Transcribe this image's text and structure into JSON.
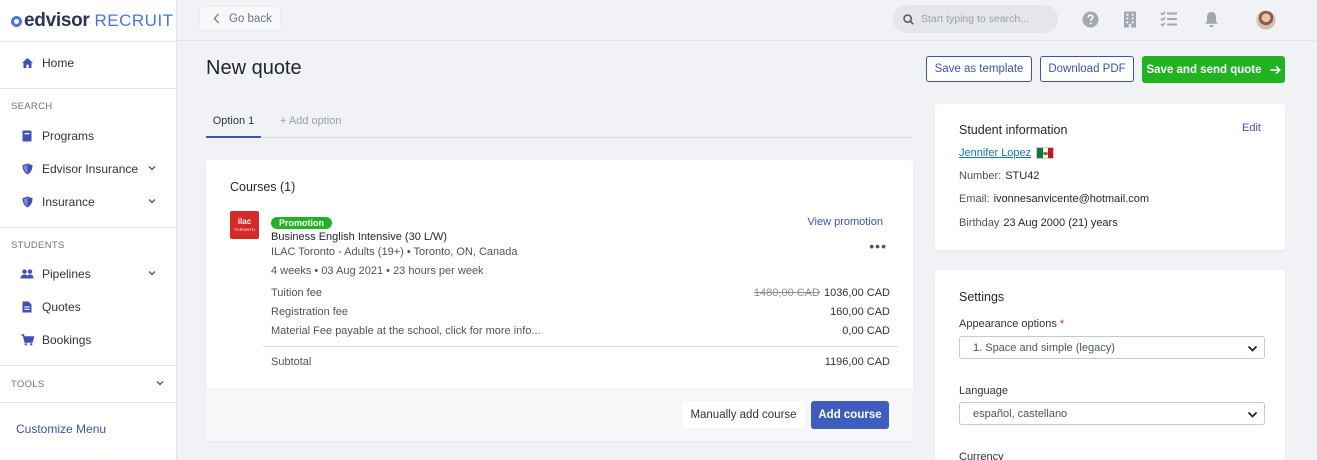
{
  "app": {
    "brand": "edvisor",
    "product": "RECRUIT"
  },
  "sidebar": {
    "home": "Home",
    "search_section": "SEARCH",
    "programs": "Programs",
    "edvisor_insurance": "Edvisor Insurance",
    "insurance": "Insurance",
    "students_section": "STUDENTS",
    "pipelines": "Pipelines",
    "quotes": "Quotes",
    "bookings": "Bookings",
    "tools_section": "TOOLS",
    "customize": "Customize Menu"
  },
  "topbar": {
    "go_back": "Go back",
    "search_placeholder": "Start typing to search..."
  },
  "page": {
    "title": "New quote",
    "save_template": "Save as template",
    "download_pdf": "Download PDF",
    "save_send": "Save and send quote"
  },
  "tabs": {
    "option1": "Option 1",
    "add_option": "+ Add option"
  },
  "courses": {
    "title": "Courses (1)",
    "school_logo_text": "ilac",
    "school_logo_sub": "TORONTO",
    "promo_badge": "Promotion",
    "view_promotion": "View promotion",
    "course_name": "Business English Intensive (30 L/W)",
    "school_line": "ILAC Toronto - Adults (19+) • Toronto, ON, Canada",
    "duration_line": "4 weeks • 03 Aug 2021 • 23 hours per week",
    "fees": [
      {
        "label": "Tuition fee",
        "old": "1480,00 CAD",
        "value": "1036,00 CAD"
      },
      {
        "label": "Registration fee",
        "old": "",
        "value": "160,00 CAD"
      },
      {
        "label": "Material Fee payable at the school, click for more info...",
        "old": "",
        "value": "0,00 CAD"
      }
    ],
    "subtotal_label": "Subtotal",
    "subtotal_value": "1196,00 CAD",
    "manual_add": "Manually add course",
    "add_course": "Add course"
  },
  "student": {
    "title": "Student information",
    "edit": "Edit",
    "name": "Jennifer Lopez",
    "number_label": "Number:",
    "number": "STU42",
    "email_label": "Email:",
    "email": "ivonnesanvicente@hotmail.com",
    "birthday_label": "Birthday",
    "birthday": "23 Aug 2000 (21) years"
  },
  "settings": {
    "title": "Settings",
    "appearance_label": "Appearance options",
    "required_mark": "*",
    "appearance_value": "1. Space and simple (legacy)",
    "language_label": "Language",
    "language_value": "español, castellano",
    "currency_label": "Currency"
  },
  "colors": {
    "accent": "#3f51b5",
    "primary_green": "#21b321",
    "promo_green": "#21b321",
    "link": "#1a73c8"
  }
}
